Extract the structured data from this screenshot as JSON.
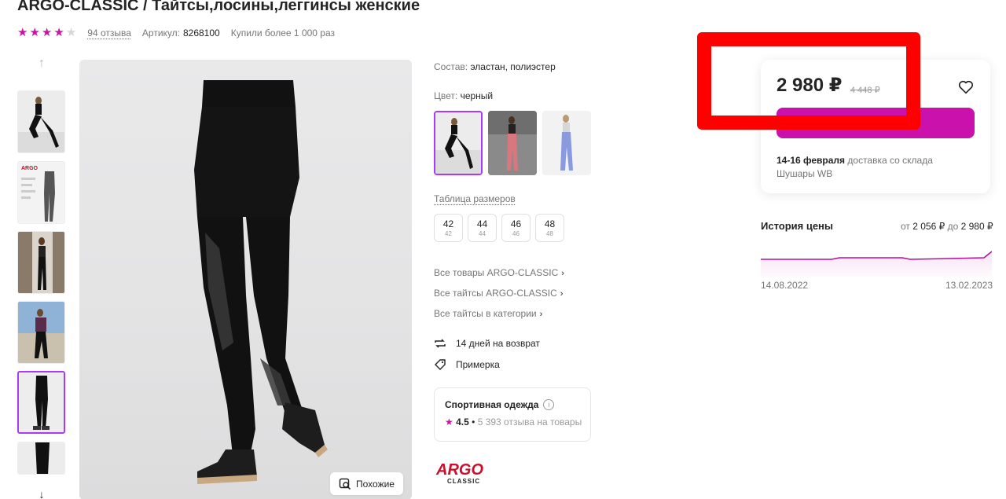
{
  "product": {
    "title": "ARGO-CLASSIC / Тайтсы,лосины,леггинсы женские",
    "rating_stars": 4,
    "reviews_link": "94 отзыва",
    "article_label": "Артикул:",
    "article_value": "8268100",
    "bought": "Купили более 1 000 раз"
  },
  "gallery": {
    "similar_button": "Похожие"
  },
  "details": {
    "composition_label": "Состав:",
    "composition_value": "эластан, полиэстер",
    "color_label": "Цвет:",
    "color_value": "черный",
    "size_table_link": "Таблица размеров",
    "sizes": [
      {
        "main": "42",
        "sub": "42"
      },
      {
        "main": "44",
        "sub": "44"
      },
      {
        "main": "46",
        "sub": "46"
      },
      {
        "main": "48",
        "sub": "48"
      }
    ],
    "links": [
      "Все товары ARGO-CLASSIC",
      "Все тайтсы ARGO-CLASSIC",
      "Все тайтсы в категории"
    ],
    "returns": "14 дней на возврат",
    "fitting": "Примерка"
  },
  "seller": {
    "name": "Спортивная одежда",
    "rating": "4.5",
    "reviews": "5 393 отзыва на товары",
    "brand_logo_top": "ARGO",
    "brand_logo_bottom": "CLASSIC"
  },
  "price": {
    "current": "2 980 ₽",
    "old": "4 448 ₽",
    "delivery_date": "14-16 февраля",
    "delivery_text": "доставка со склада",
    "warehouse": "Шушары WB"
  },
  "price_history": {
    "title": "История цены",
    "range_from_label": "от",
    "range_from": "2 056 ₽",
    "range_to_label": "до",
    "range_to": "2 980 ₽",
    "start_date": "14.08.2022",
    "end_date": "13.02.2023"
  },
  "colors": {
    "accent": "#cb11ab",
    "selection": "#a73afd",
    "highlight": "#ff0000"
  }
}
